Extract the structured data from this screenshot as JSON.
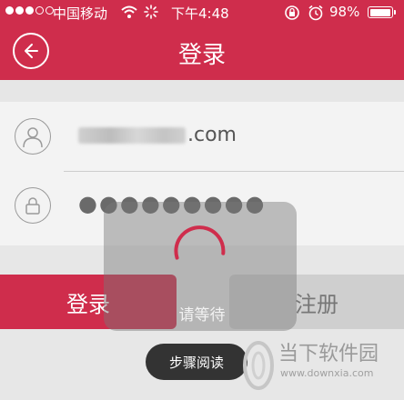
{
  "status_bar": {
    "carrier": "中国移动",
    "time": "下午4:48",
    "battery": "98%",
    "battery_level": 0.98
  },
  "header": {
    "title": "登录"
  },
  "form": {
    "account_suffix": ".com",
    "password_mask": "●●●●●●●●●"
  },
  "buttons": {
    "login": "登录",
    "register": "注册"
  },
  "loading": {
    "text": "请等待"
  },
  "step_pill": {
    "label": "步骤阅读"
  },
  "watermark": {
    "title": "当下软件园",
    "url": "www.downxia.com"
  },
  "colors": {
    "brand": "#cf2d4c"
  }
}
